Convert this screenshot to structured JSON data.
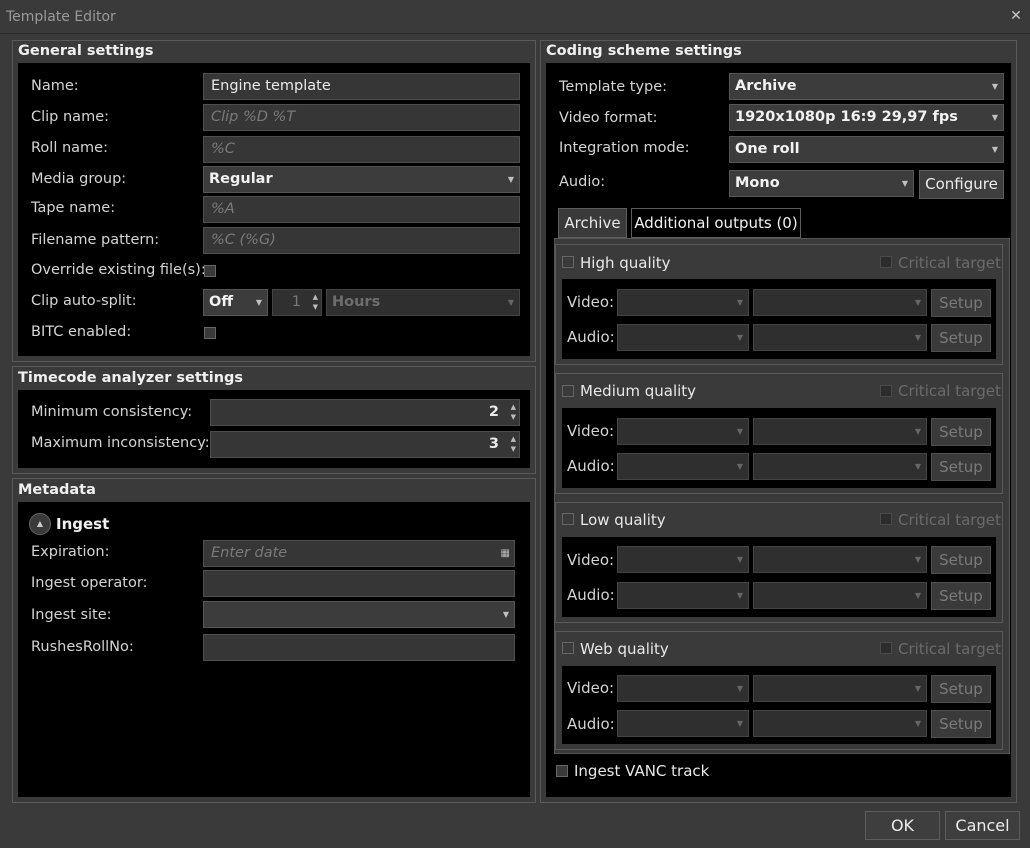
{
  "window": {
    "title": "Template Editor",
    "close_glyph": "✕"
  },
  "general": {
    "title": "General settings",
    "name_label": "Name:",
    "name_value": "Engine template",
    "clip_label": "Clip name:",
    "clip_placeholder": "Clip %D %T",
    "roll_label": "Roll name:",
    "roll_placeholder": "%C",
    "media_label": "Media group:",
    "media_value": "Regular",
    "tape_label": "Tape name:",
    "tape_placeholder": "%A",
    "filename_label": "Filename pattern:",
    "filename_placeholder": "%C (%G)",
    "override_label": "Override existing file(s):",
    "split_label": "Clip auto-split:",
    "split_mode": "Off",
    "split_count": "1",
    "split_unit": "Hours",
    "bitc_label": "BITC enabled:"
  },
  "timecode": {
    "title": "Timecode analyzer settings",
    "min_label": "Minimum consistency:",
    "min_value": "2",
    "max_label": "Maximum inconsistency:",
    "max_value": "3"
  },
  "metadata": {
    "title": "Metadata",
    "ingest_label": "Ingest",
    "expiration_label": "Expiration:",
    "expiration_placeholder": "Enter date",
    "operator_label": "Ingest operator:",
    "site_label": "Ingest site:",
    "rushes_label": "RushesRollNo:"
  },
  "coding": {
    "title": "Coding scheme settings",
    "type_label": "Template type:",
    "type_value": "Archive",
    "format_label": "Video format:",
    "format_value": "1920x1080p 16:9 29,97 fps",
    "integration_label": "Integration mode:",
    "integration_value": "One roll",
    "audio_label": "Audio:",
    "audio_value": "Mono",
    "configure_label": "Configure",
    "tabs": [
      "Archive",
      "Additional outputs (0)"
    ],
    "groups": [
      {
        "name": "High quality"
      },
      {
        "name": "Medium quality"
      },
      {
        "name": "Low quality"
      },
      {
        "name": "Web quality"
      }
    ],
    "critical_label": "Critical target",
    "video_label": "Video:",
    "audio_row_label": "Audio:",
    "setup_label": "Setup",
    "vanc_label": "Ingest VANC track"
  },
  "footer": {
    "ok_label": "OK",
    "cancel_label": "Cancel"
  },
  "colors": {
    "background": "#3a3a3a",
    "panel_body": "#000000",
    "text": "#e0e0e0"
  }
}
